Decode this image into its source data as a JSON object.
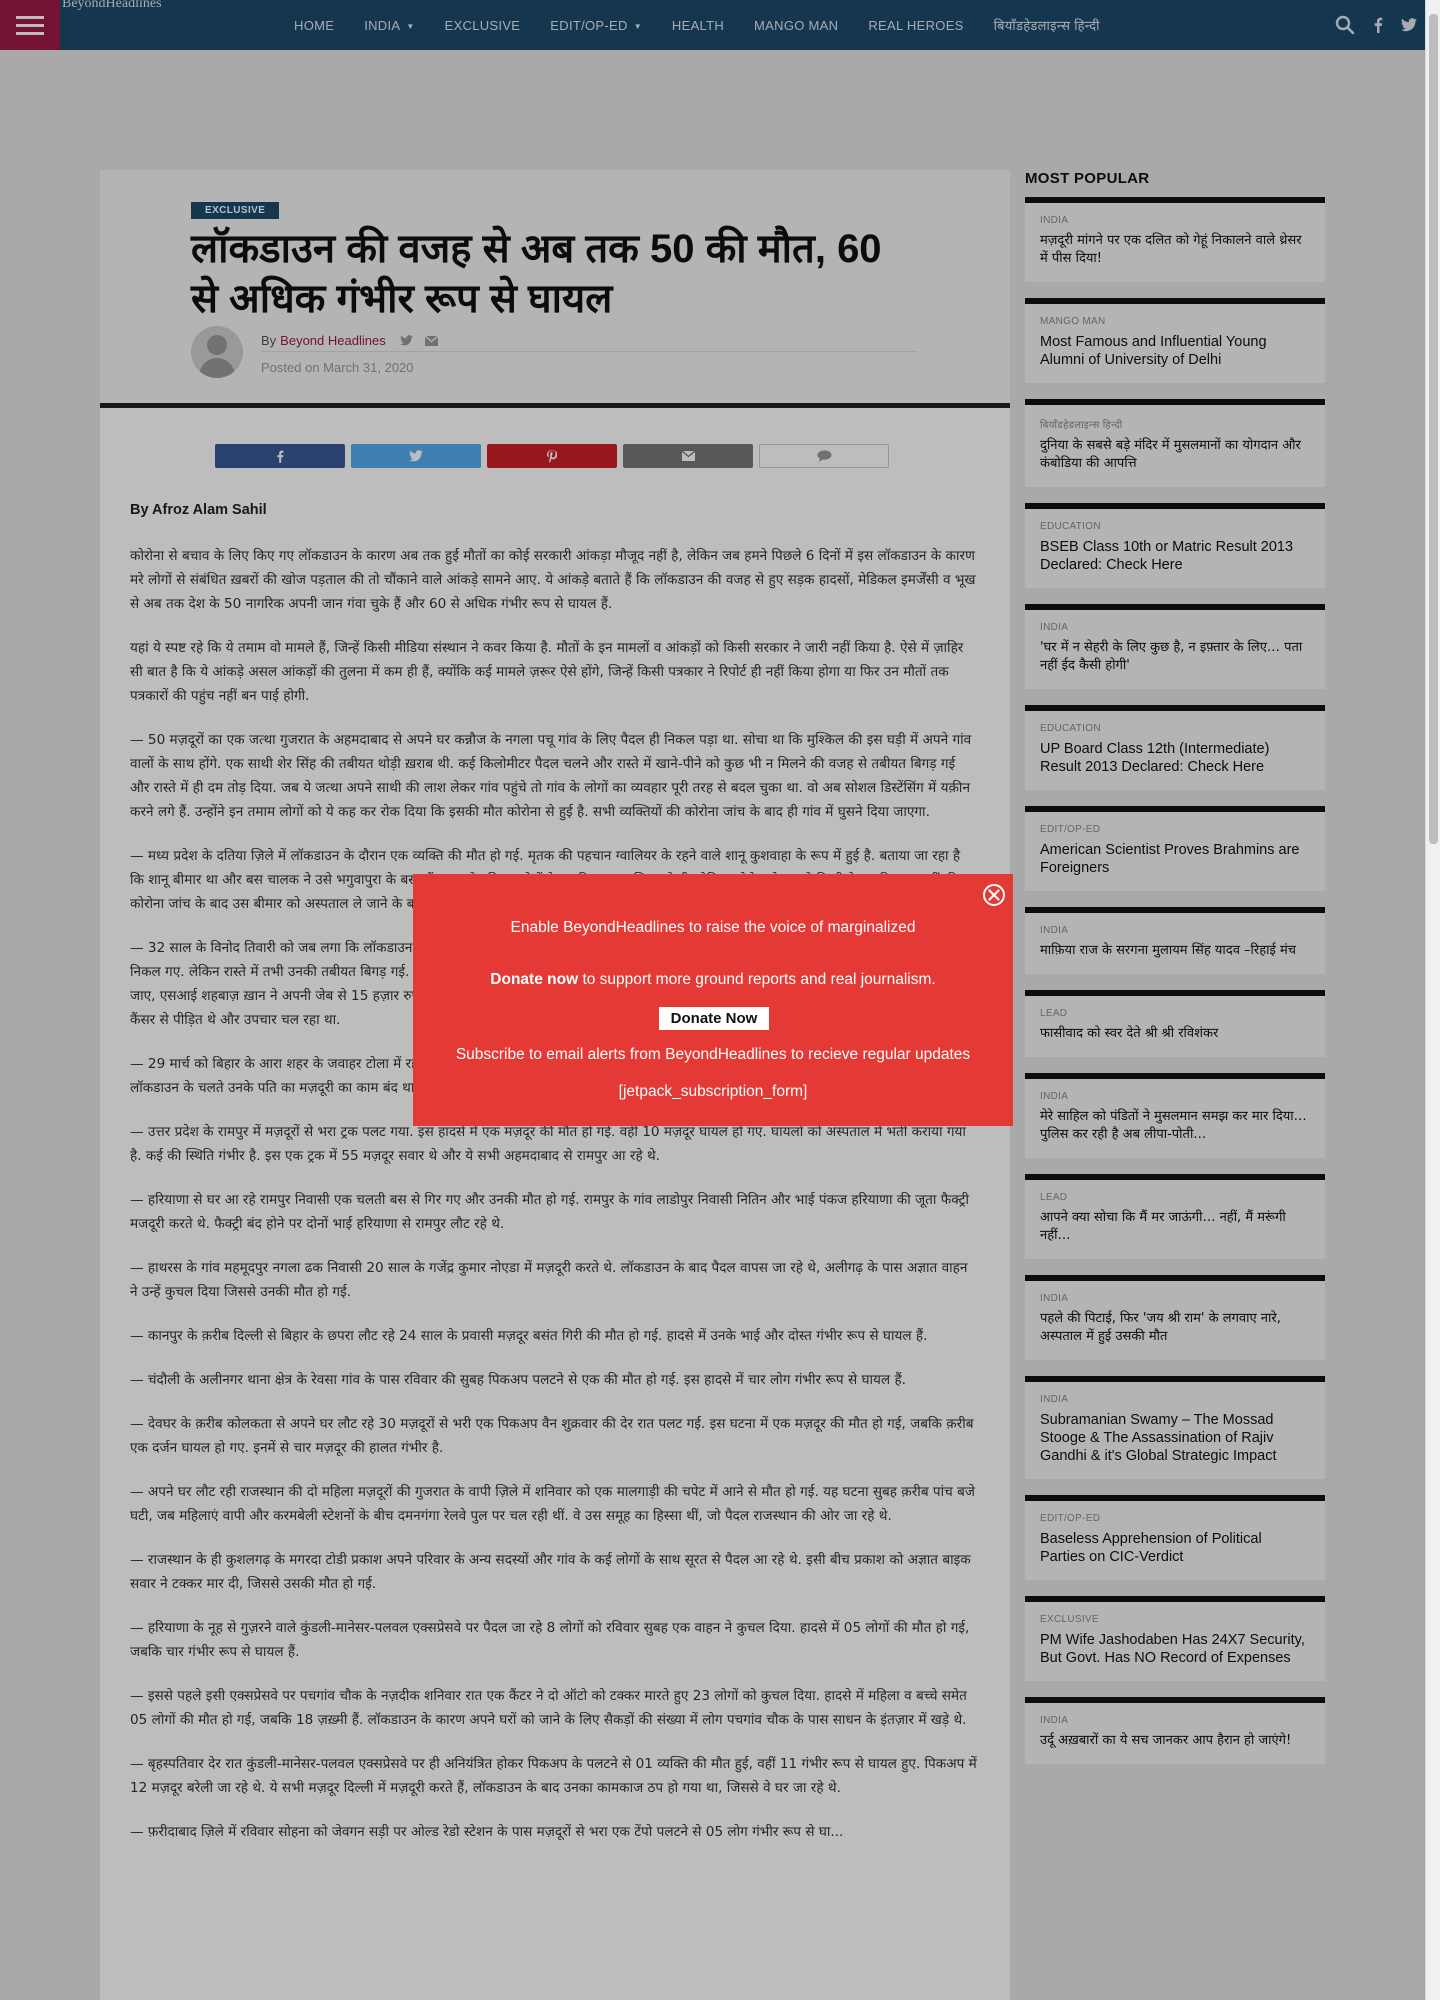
{
  "site": {
    "logo_alt": "BeyondHeadlines"
  },
  "nav": {
    "items": [
      {
        "label": "HOME",
        "dropdown": false
      },
      {
        "label": "INDIA",
        "dropdown": true
      },
      {
        "label": "EXCLUSIVE",
        "dropdown": false
      },
      {
        "label": "EDIT/OP-ED",
        "dropdown": true
      },
      {
        "label": "HEALTH",
        "dropdown": false
      },
      {
        "label": "MANGO MAN",
        "dropdown": false
      },
      {
        "label": "REAL HEROES",
        "dropdown": false
      },
      {
        "label": "बियॉंडहेडलाइन्स हिन्दी",
        "dropdown": false
      }
    ],
    "icons": [
      "search-icon",
      "facebook-icon",
      "twitter-icon"
    ]
  },
  "article": {
    "category": "EXCLUSIVE",
    "title": "लॉकडाउन की वजह से अब तक 50 की मौत, 60 से अधिक गंभीर रूप से घायल",
    "by_prefix": "By",
    "author": "Beyond Headlines",
    "posted_prefix": "Posted on",
    "posted_date": "March 31, 2020",
    "byline_author": "By Afroz Alam Sahil",
    "paragraphs": [
      "कोरोना से बचाव के लिए किए गए लॉकडाउन के कारण अब तक हुई मौतों का कोई सरकारी आंकड़ा मौजूद नहीं है, लेकिन जब हमने पिछले 6 दिनों में इस लॉकडाउन के कारण मरे लोगों से संबंधित ख़बरों की खोज पड़ताल की तो चौंकाने वाले आंकड़े सामने आए. ये आंकड़े बताते हैं कि लॉकडाउन की वजह से हुए सड़क हादसों, मेडिकल इमर्जेंसी व भूख से अब तक देश के 50 नागरिक अपनी जान गंवा चुके हैं और 60 से अधिक गंभीर रूप से घायल हैं.",
      "यहां ये स्पष्ट रहे कि ये तमाम वो मामले हैं, जिन्हें किसी मीडिया संस्थान ने कवर किया है.  मौतों के इन मामलों व आंकड़ों को किसी सरकार ने जारी नहीं किया है. ऐसे में ज़ाहिर सी बात है कि ये आंकड़े असल आंकड़ों की तुलना में कम ही हैं, क्योंकि कई मामले ज़रूर ऐसे होंगे, जिन्हें किसी पत्रकार ने रिपोर्ट ही नहीं किया होगा या फिर उन मौतों तक पत्रकारों की पहुंच नहीं बन पाई होगी.",
      "— 50 मज़दूरों का एक जत्था गुजरात के अहमदाबाद से अपने घर कन्नौज के नगला पचू गांव के लिए पैदल ही निकल पड़ा था. सोचा था कि मुश्किल की इस घड़ी में अपने गांव वालों के साथ होंगे. एक साथी शेर सिंह की तबीयत थोड़ी ख़राब थी. कई किलोमीटर पैदल चलने और रास्ते में खाने-पीने को कुछ भी न मिलने की वजह से तबीयत बिगड़ गई और रास्ते में ही दम तोड़ दिया. जब ये जत्था अपने साथी की लाश लेकर गांव पहुंचे तो गांव के लोगों का व्यवहार पूरी तरह से बदल चुका था. वो अब सोशल डिस्टेंसिंग में यक़ीन करने लगे हैं. उन्होंने इन तमाम लोगों को ये कह कर रोक दिया कि इसकी मौत कोरोना से हुई है. सभी व्यक्तियों की कोरोना जांच के बाद ही गांव में घुसने दिया जाएगा.",
      "— मध्य प्रदेश के दतिया ज़िले में लॉकडाउन के दौरान एक व्यक्ति की मौत हो गई. मृतक की पहचान ग्वालियर के रहने वाले शानू कुशवाहा के रूप में हुई है. बताया जा रहा है कि शानू बीमार था और बस चालक ने उसे भगुवापुरा के बस स्टैंड पर छोड़ दिया. लोगों ने इसकी सूचना पुलिस को दी, लेकिन कोरोना के डर से किसी ने उसकी मदद नहीं की. कोरोना जांच के बाद उस बीमार को अस्पताल ले जाने के बजाए...",
      "— 32 साल के विनोद तिवारी को जब लगा कि लॉकडाउन में अब कोई काम नहीं मिलेगा तो वह दिल्ली से अपने साथियों के साथ मोपेड से ही अपने घर सिद्धार्थनगर के लिए निकल गए. लेकिन रास्ते में तभी उनकी तबीयत बिगड़ गई. मोपेड रोकते ही ज़मीन पर गिर पड़े और दम तोड़ दिया. प्रशासन का आदेश था कि मृत शरीर को अस्पताल ले जाया जाए, एसआई शहबाज़ ख़ान ने अपनी जेब से 15 हज़ार रुपये देकर एंबुलेंस की व्यवस्था कराई. वो अपने परिवार के साथ किराए के मकान में रहते थे. वो काफ़ी समय से मुंह में कैंसर से पीड़ित थे और उपचार चल रहा था.",
      "— 29 मार्च को बिहार के आरा शहर के जवाहर टोला में रहने वाले 8 साल के राकेश की मौत कथित तौर पर 26 मार्च को भूख की वजह से हो गई. उनकी मां का कहना है कि लॉकडाउन के चलते उनके पति का मज़दूरी का काम बंद था, जिसके चलते 24 मार्च के बाद उनके घर खाना नहीं बना था.",
      "— उत्तर प्रदेश के रामपुर में मज़दूरों से भरा ट्रक पलट गया. इस हादसे में एक मज़दूर की मौत हो गई. वहीं 10 मज़दूर घायल हो गए. घायलों को अस्पताल में भर्ती कराया गया है. कई की स्थिति गंभीर है. इस एक ट्रक में 55 मज़दूर सवार थे और ये सभी अहमदाबाद से रामपुर आ रहे थे.",
      "— हरियाणा से घर आ रहे रामपुर निवासी एक चलती बस से गिर गए और उनकी मौत हो गई. रामपुर के गांव लाडोपुर निवासी नितिन और भाई पंकज हरियाणा की जूता फैक्ट्री मजदूरी करते थे. फैक्ट्री बंद होने पर दोनों भाई हरियाणा से रामपुर लौट रहे थे.",
      "— हाथरस के गांव महमूदपुर नगला ढक निवासी 20 साल के गजेंद्र कुमार नोएडा में मज़दूरी करते थे. लॉकडाउन के बाद पैदल वापस जा रहे थे, अलीगढ़ के पास अज्ञात वाहन ने उन्हें कुचल दिया जिससे उनकी मौत हो गई.",
      "— कानपुर के क़रीब दिल्ली से बिहार के छपरा लौट रहे 24 साल के प्रवासी मज़दूर बसंत गिरी की मौत हो गई. हादसे में उनके भाई और दोस्त गंभीर रूप से घायल हैं.",
      "— चंदौली के अलीनगर थाना क्षेत्र के रेवसा गांव के पास रविवार की सुबह पिकअप पलटने से एक की मौत हो गई. इस हादसे में चार लोग गंभीर रूप से घायल हैं.",
      "— देवघर के क़रीब कोलकता से अपने घर लौट रहे 30 मज़दूरों से भरी एक पिकअप वैन शुक्रवार की देर रात पलट गई. इस घटना में एक मज़दूर की मौत हो गई, जबकि क़रीब एक दर्जन घायल हो गए. इनमें से चार मज़दूर की हालत गंभीर है.",
      "— अपने घर लौट रही राजस्थान की दो महिला मज़दूरों की गुजरात के वापी ज़िले में शनिवार को एक मालगाड़ी की चपेट में आने से मौत हो गई. यह घटना सुबह क़रीब पांच बजे घटी, जब महिलाएं वापी और करमबेली स्टेशनों के बीच दमनगंगा रेलवे पुल पर चल रही थीं. वे उस समूह का हिस्सा थीं, जो पैदल राजस्थान की ओर जा रहे थे.",
      "— राजस्थान के ही कुशलगढ़ के मगरदा टोडी प्रकाश अपने परिवार के अन्य सदस्यों और गांव के कई लोगों के साथ सूरत से पैदल आ रहे थे. इसी बीच प्रकाश को अज्ञात बाइक सवार ने टक्कर मार दी, जिससे उसकी मौत हो गई.",
      "— हरियाणा के नूह से गुज़रने वाले कुंडली-मानेसर-पलवल एक्सप्रेसवे पर पैदल जा रहे 8 लोगों को रविवार सुबह एक वाहन ने कुचल दिया. हादसे में 05 लोगों की मौत हो गई, जबकि चार गंभीर रूप से घायल हैं.",
      "— इससे पहले इसी एक्सप्रेसवे पर पचगांव चौक के नज़दीक शनिवार रात एक कैंटर ने दो ऑटो को टक्कर मारते हुए 23 लोगों को कुचल दिया. हादसे में महिला व बच्चे समेत 05 लोगों की मौत हो गई, जबकि 18 ज़ख़्मी हैं. लॉकडाउन के कारण अपने घरों को जाने के लिए सैकड़ों की संख्या में लोग पचगांव चौक के पास साधन के इंतज़ार में खड़े थे.",
      "— बृहस्पतिवार देर रात कुंडली-मानेसर-पलवल एक्सप्रेसवे पर ही अनियंत्रित होकर पिकअप के पलटने से 01 व्यक्ति की मौत हुई, वहीं 11 गंभीर रूप से घायल हुए. पिकअप में 12 मज़दूर बरेली जा रहे थे. ये सभी मज़दूर दिल्ली में मज़दूरी करते हैं, लॉकडाउन के बाद उनका कामकाज ठप हो गया था, जिससे वे घर जा रहे थे.",
      "— फ़रीदाबाद ज़िले में रविवार सोहना को जेवगन सड़ी पर ओल्ड रेडो स्टेशन के पास मज़दूरों से भरा एक टेंपो पलटने से 05 लोग गंभीर रूप से घा..."
    ]
  },
  "share": {
    "buttons": [
      {
        "name": "facebook-share-button",
        "icon": "facebook-icon"
      },
      {
        "name": "twitter-share-button",
        "icon": "twitter-icon"
      },
      {
        "name": "pinterest-share-button",
        "icon": "pinterest-icon"
      },
      {
        "name": "email-share-button",
        "icon": "email-icon"
      },
      {
        "name": "comment-button",
        "icon": "comment-icon"
      }
    ]
  },
  "sidebar": {
    "heading": "MOST POPULAR",
    "items": [
      {
        "category": "INDIA",
        "title": "मज़दूरी मांगने पर एक दलित को गेहूं निकालने वाले थ्रेसर में पीस दिया!",
        "hindi": true
      },
      {
        "category": "MANGO MAN",
        "title": "Most Famous and Influential Young Alumni of University of Delhi",
        "hindi": false
      },
      {
        "category": "बियॉंडहेडलाइन्स हिन्दी",
        "title": "दुनिया के सबसे बड़े मंदिर में मुसलमानों का योगदान और कंबोडिया की आपत्ति",
        "hindi": true
      },
      {
        "category": "EDUCATION",
        "title": "BSEB Class 10th or Matric Result 2013 Declared: Check Here",
        "hindi": false
      },
      {
        "category": "INDIA",
        "title": "'घर में न सेहरी के लिए कुछ है, न इफ़्तार के लिए… पता नहीं ईद कैसी होगी'",
        "hindi": true
      },
      {
        "category": "EDUCATION",
        "title": "UP Board Class 12th (Intermediate) Result 2013 Declared: Check Here",
        "hindi": false
      },
      {
        "category": "EDIT/OP-ED",
        "title": "American Scientist Proves Brahmins are Foreigners",
        "hindi": false
      },
      {
        "category": "INDIA",
        "title": "माफ़िया राज के सरगना मुलायम सिंह यादव –रिहाई मंच",
        "hindi": true
      },
      {
        "category": "LEAD",
        "title": "फासीवाद को स्वर देते श्री श्री रविशंकर",
        "hindi": true
      },
      {
        "category": "INDIA",
        "title": "मेरे साहिल को पंडितों ने मुसलमान समझ कर मार दिया… पुलिस कर रही है अब लीपा-पोती…",
        "hindi": true
      },
      {
        "category": "LEAD",
        "title": "आपने क्या सोचा कि मैं मर जाऊंगी… नहीं, मैं मरूंगी नहीं…",
        "hindi": true
      },
      {
        "category": "INDIA",
        "title": "पहले की पिटाई, फिर 'जय श्री राम' के लगवाए नारे, अस्पताल में हुई उसकी मौत",
        "hindi": true
      },
      {
        "category": "INDIA",
        "title": "Subramanian Swamy – The Mossad Stooge & The Assassination of Rajiv Gandhi & it's Global Strategic Impact",
        "hindi": false
      },
      {
        "category": "EDIT/OP-ED",
        "title": "Baseless Apprehension of Political Parties on CIC-Verdict",
        "hindi": false
      },
      {
        "category": "EXCLUSIVE",
        "title": "PM Wife Jashodaben Has 24X7 Security, But Govt. Has NO Record of Expenses",
        "hindi": false
      },
      {
        "category": "INDIA",
        "title": "उर्दू अख़बारों का ये सच जानकर आप हैरान हो जाएंगे!",
        "hindi": true
      }
    ]
  },
  "popup": {
    "line1": "Enable BeyondHeadlines to raise the voice of marginalized",
    "donate_bold": "Donate now",
    "donate_rest": " to support more ground reports and real journalism.",
    "button_label": "Donate Now",
    "line3": "Subscribe to email alerts from BeyondHeadlines to recieve regular updates",
    "shortcode": "[jetpack_subscription_form]"
  },
  "colors": {
    "nav_bg": "#1b4a6b",
    "hamburger_bg": "#9e1a49",
    "author_link": "#9e1a49",
    "popup_bg": "#e53935",
    "facebook": "#3b5998",
    "twitter": "#55acee",
    "pinterest": "#cb2027"
  }
}
